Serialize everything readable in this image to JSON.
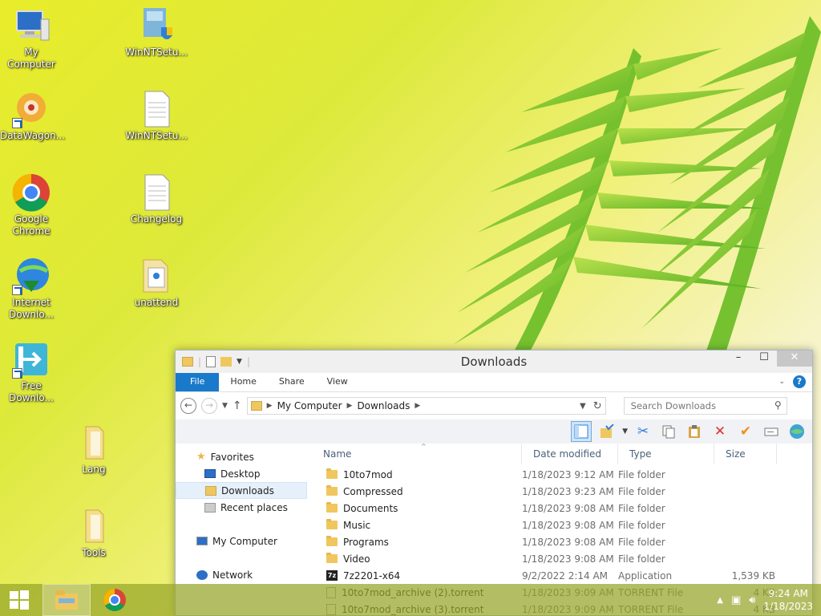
{
  "desktop": {
    "icons": [
      {
        "label": "My Computer"
      },
      {
        "label": "DataWagon..."
      },
      {
        "label": "Google Chrome"
      },
      {
        "label": "Internet Downlo..."
      },
      {
        "label": "Free Downlo..."
      },
      {
        "label": "WinNTSetu..."
      },
      {
        "label": "WinNTSetu..."
      },
      {
        "label": "Changelog"
      },
      {
        "label": "unattend"
      },
      {
        "label": "Lang"
      },
      {
        "label": "Tools"
      }
    ]
  },
  "window": {
    "title": "Downloads",
    "tabs": [
      "File",
      "Home",
      "Share",
      "View"
    ],
    "address": {
      "crumbs": [
        "My Computer",
        "Downloads"
      ]
    },
    "search_placeholder": "Search Downloads",
    "nav": {
      "favorites": "Favorites",
      "desktop": "Desktop",
      "downloads": "Downloads",
      "recent": "Recent places",
      "computer": "My Computer",
      "network": "Network"
    },
    "columns": {
      "name": "Name",
      "date": "Date modified",
      "type": "Type",
      "size": "Size"
    },
    "files": [
      {
        "name": "10to7mod",
        "date": "1/18/2023 9:12 AM",
        "type": "File folder",
        "size": "",
        "kind": "folder"
      },
      {
        "name": "Compressed",
        "date": "1/18/2023 9:23 AM",
        "type": "File folder",
        "size": "",
        "kind": "folder"
      },
      {
        "name": "Documents",
        "date": "1/18/2023 9:08 AM",
        "type": "File folder",
        "size": "",
        "kind": "folder"
      },
      {
        "name": "Music",
        "date": "1/18/2023 9:08 AM",
        "type": "File folder",
        "size": "",
        "kind": "folder"
      },
      {
        "name": "Programs",
        "date": "1/18/2023 9:08 AM",
        "type": "File folder",
        "size": "",
        "kind": "folder"
      },
      {
        "name": "Video",
        "date": "1/18/2023 9:08 AM",
        "type": "File folder",
        "size": "",
        "kind": "folder"
      },
      {
        "name": "7z2201-x64",
        "date": "9/2/2022 2:14 AM",
        "type": "Application",
        "size": "1,539 KB",
        "kind": "app"
      },
      {
        "name": "10to7mod_archive (2).torrent",
        "date": "1/18/2023 9:09 AM",
        "type": "TORRENT File",
        "size": "4 KB",
        "kind": "file"
      },
      {
        "name": "10to7mod_archive (3).torrent",
        "date": "1/18/2023 9:09 AM",
        "type": "TORRENT File",
        "size": "4 KB",
        "kind": "file"
      }
    ]
  },
  "taskbar": {
    "time": "9:24 AM",
    "date": "1/18/2023"
  },
  "colors": {
    "accent": "#1979ca",
    "folder": "#f0c75e"
  }
}
